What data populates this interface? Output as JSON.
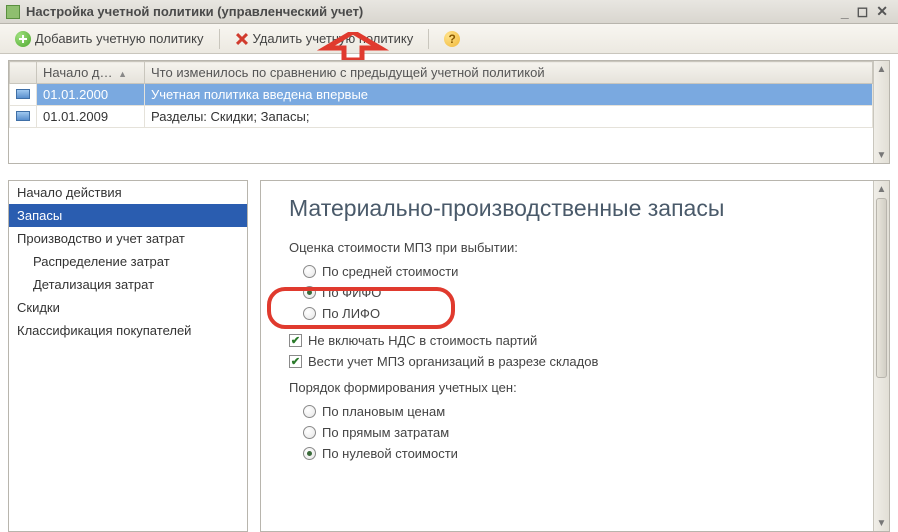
{
  "window": {
    "title": "Настройка учетной политики (управленческий учет)"
  },
  "toolbar": {
    "add_label": "Добавить учетную политику",
    "delete_label": "Удалить учетную политику"
  },
  "table": {
    "headers": {
      "date": "Начало д…",
      "what": "Что изменилось по сравнению с предыдущей учетной политикой"
    },
    "rows": [
      {
        "date": "01.01.2000",
        "what": "Учетная политика введена впервые"
      },
      {
        "date": "01.01.2009",
        "what": "Разделы: Скидки; Запасы;"
      }
    ]
  },
  "sidebar": {
    "items": [
      {
        "label": "Начало действия"
      },
      {
        "label": "Запасы"
      },
      {
        "label": "Производство и учет затрат"
      },
      {
        "label": "Распределение затрат"
      },
      {
        "label": "Детализация затрат"
      },
      {
        "label": "Скидки"
      },
      {
        "label": "Классификация покупателей"
      }
    ]
  },
  "content": {
    "heading": "Материально-производственные запасы",
    "eval_label": "Оценка стоимости МПЗ при выбытии:",
    "radios_eval": [
      "По средней стоимости",
      "По ФИФО",
      "По ЛИФО"
    ],
    "checks": [
      "Не включать НДС в стоимость партий",
      "Вести учет МПЗ организаций в разрезе складов"
    ],
    "price_label": "Порядок формирования учетных цен:",
    "radios_price": [
      "По плановым ценам",
      "По прямым затратам",
      "По нулевой стоимости"
    ]
  }
}
